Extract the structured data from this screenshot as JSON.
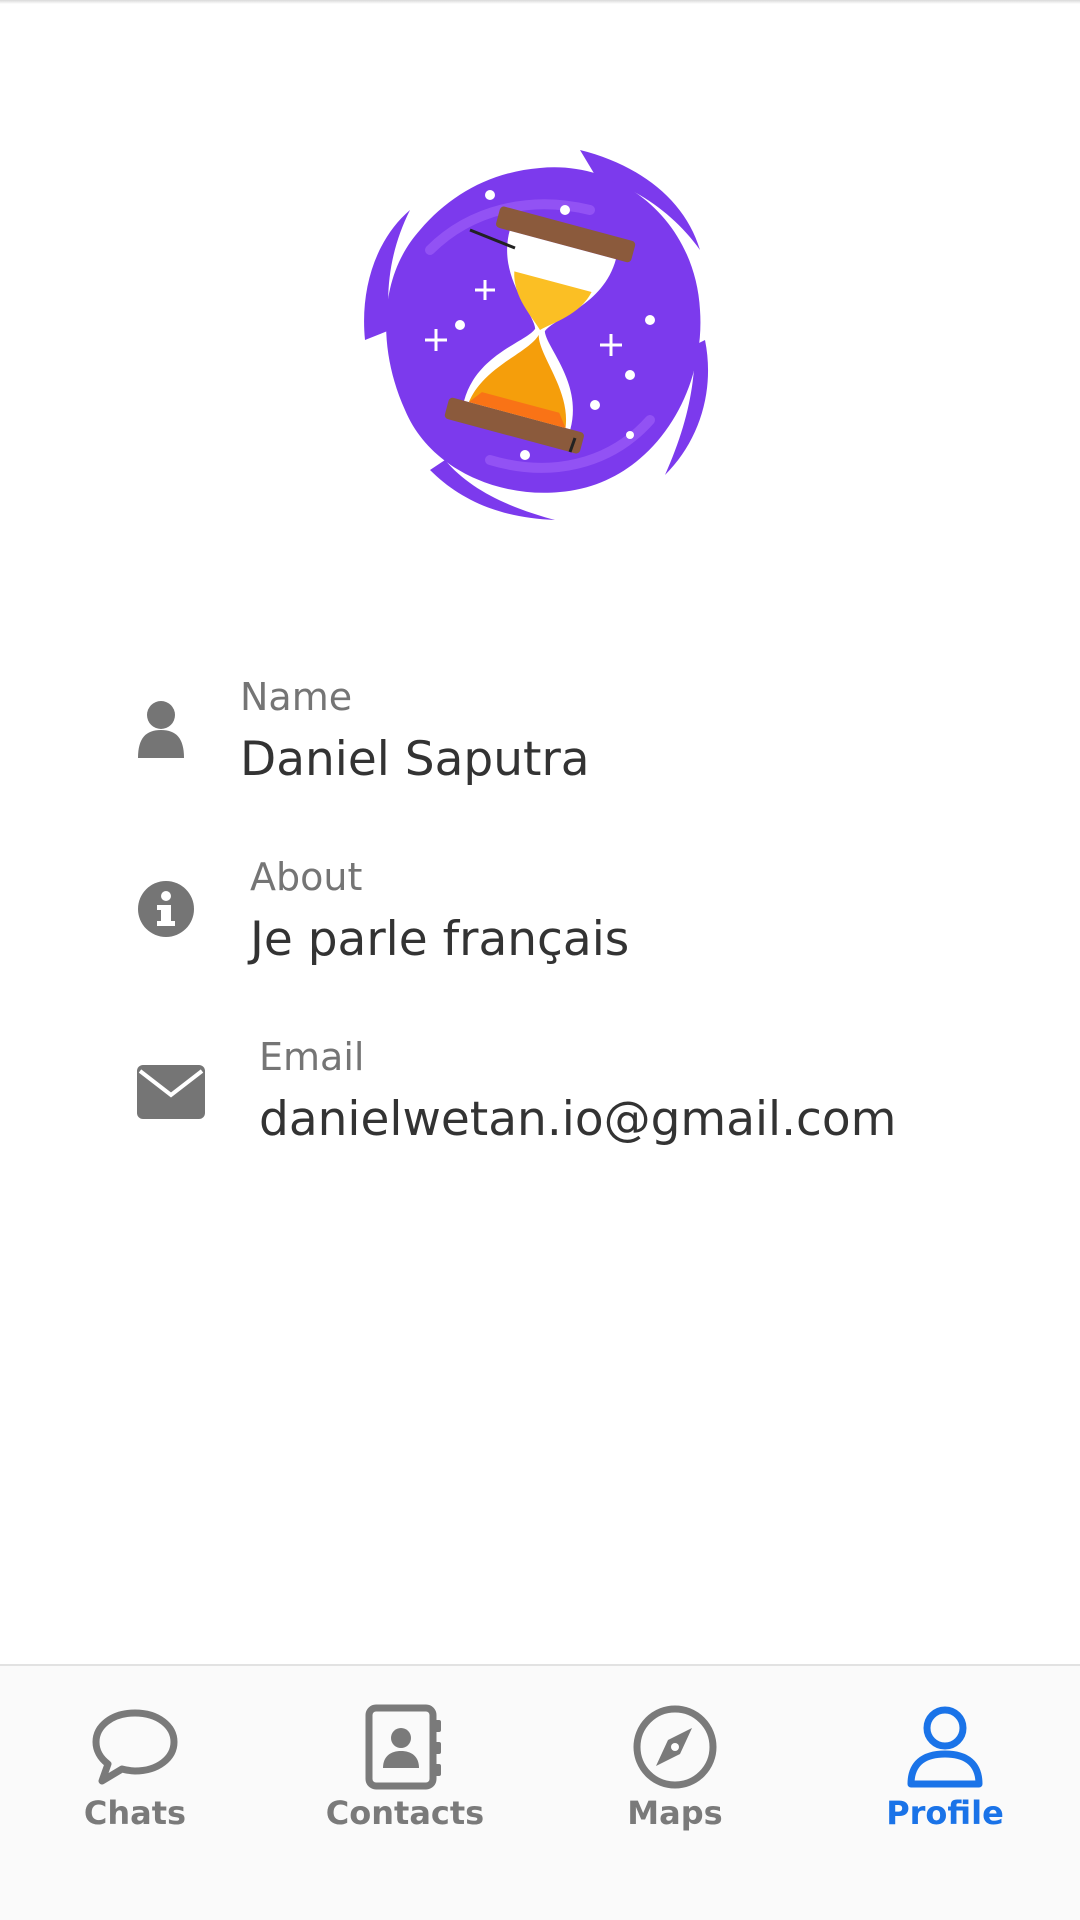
{
  "profile": {
    "fields": [
      {
        "icon": "person-icon",
        "label": "Name",
        "value": "Daniel Saputra"
      },
      {
        "icon": "info-icon",
        "label": "About",
        "value": "Je parle français"
      },
      {
        "icon": "envelope-icon",
        "label": "Email",
        "value": "danielwetan.io@gmail.com"
      }
    ]
  },
  "bottom_nav": {
    "active": "Profile",
    "active_color": "#1a73e8",
    "inactive_color": "#7a7a7a",
    "items": [
      {
        "icon": "chat-bubble-icon",
        "label": "Chats"
      },
      {
        "icon": "address-book-icon",
        "label": "Contacts"
      },
      {
        "icon": "compass-icon",
        "label": "Maps"
      },
      {
        "icon": "user-outline-icon",
        "label": "Profile"
      }
    ]
  },
  "colors": {
    "avatar_purple": "#7c3aed",
    "hourglass_sand": "#f59e0b",
    "hourglass_wood": "#8b5a3c",
    "icon_gray": "#757575"
  }
}
